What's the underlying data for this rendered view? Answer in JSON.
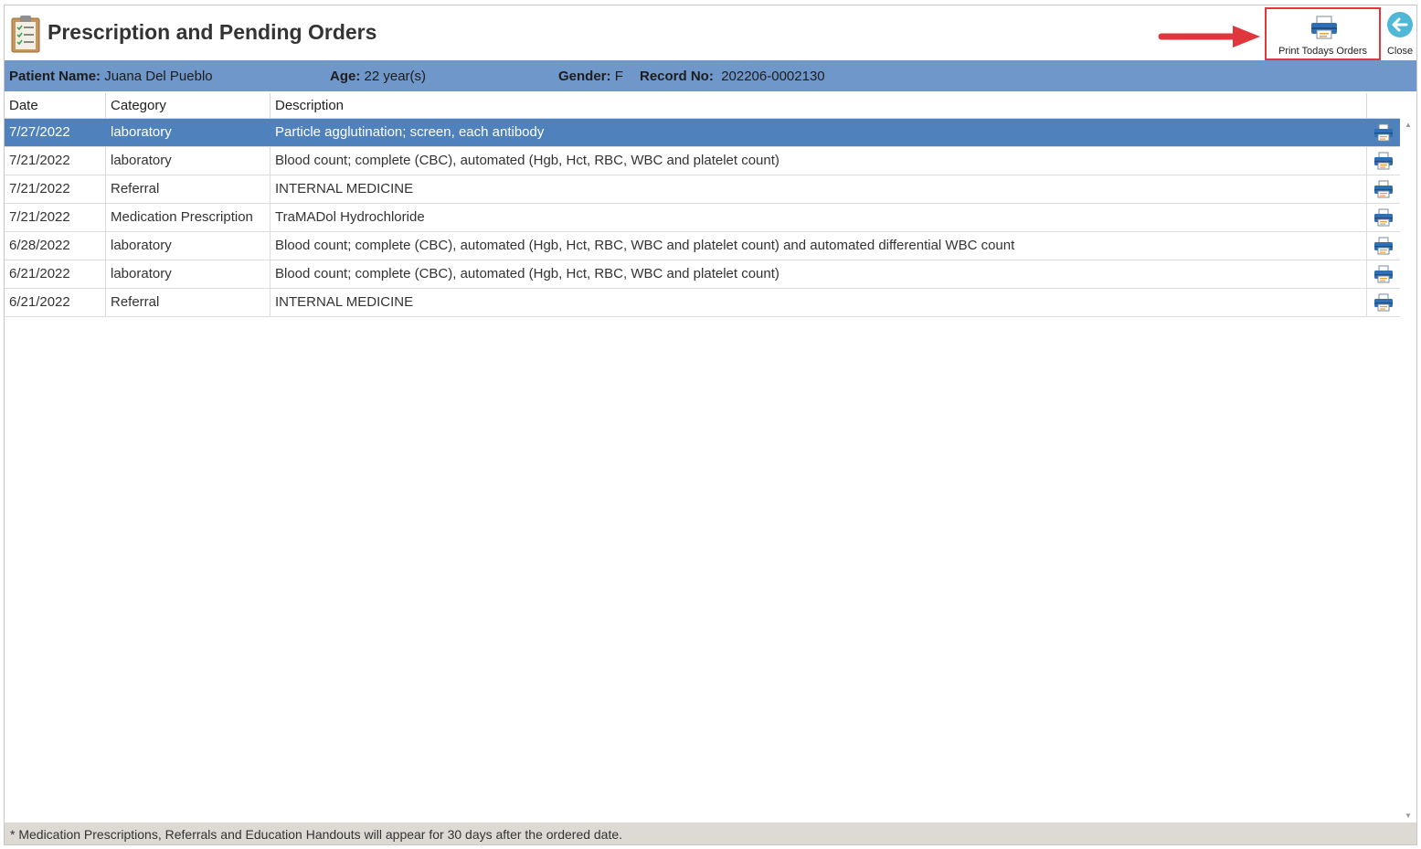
{
  "header": {
    "title": "Prescription and Pending Orders",
    "print_todays_orders_label": "Print Todays Orders",
    "close_label": "Close"
  },
  "patient": {
    "name_label": "Patient Name:",
    "name": "Juana Del Pueblo",
    "age_label": "Age:",
    "age": "22 year(s)",
    "gender_label": "Gender:",
    "gender": "F",
    "record_label": "Record No:",
    "record_no": "202206-0002130"
  },
  "grid": {
    "columns": [
      "Date",
      "Category",
      "Description"
    ],
    "rows": [
      {
        "date": "7/27/2022",
        "category": "laboratory",
        "description": "Particle agglutination; screen, each antibody",
        "selected": true
      },
      {
        "date": "7/21/2022",
        "category": "laboratory",
        "description": "Blood count; complete (CBC), automated (Hgb, Hct, RBC, WBC and platelet count)"
      },
      {
        "date": "7/21/2022",
        "category": "Referral",
        "description": "INTERNAL MEDICINE"
      },
      {
        "date": "7/21/2022",
        "category": "Medication Prescription",
        "description": "TraMADol Hydrochloride"
      },
      {
        "date": "6/28/2022",
        "category": "laboratory",
        "description": "Blood count; complete (CBC), automated (Hgb, Hct, RBC, WBC and platelet count) and automated differential WBC count"
      },
      {
        "date": "6/21/2022",
        "category": "laboratory",
        "description": "Blood count; complete (CBC), automated (Hgb, Hct, RBC, WBC and platelet count)"
      },
      {
        "date": "6/21/2022",
        "category": "Referral",
        "description": "INTERNAL MEDICINE"
      }
    ]
  },
  "footer": {
    "note": "* Medication Prescriptions, Referrals and Education Handouts will appear for 30 days after the ordered date."
  },
  "colors": {
    "patient_bar": "#6f97c9",
    "selected_row": "#4f81bd",
    "highlight_box": "#e0373e",
    "footer": "#dcdad3"
  },
  "icons": {
    "app": "clipboard-checklist-icon",
    "print": "printer-icon",
    "close": "back-arrow-circle-icon",
    "annotation": "red-arrow-icon"
  }
}
